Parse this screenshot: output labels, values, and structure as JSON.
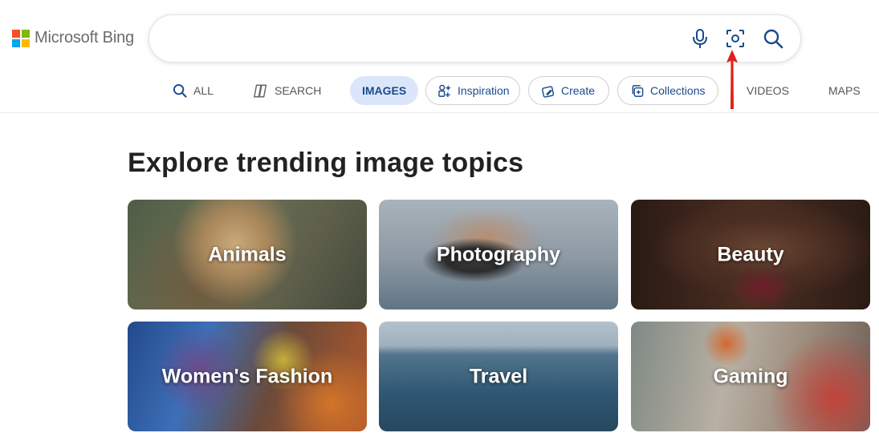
{
  "brand": {
    "logo_text": "Microsoft Bing",
    "colors": [
      "#f25022",
      "#7fba00",
      "#00a4ef",
      "#ffb900"
    ]
  },
  "search": {
    "query": "",
    "placeholder": "",
    "icons": [
      "microphone-icon",
      "visual-search-icon",
      "search-icon"
    ]
  },
  "nav": {
    "tabs": [
      {
        "label": "ALL",
        "icon": "search-icon"
      },
      {
        "label": "SEARCH",
        "icon": "copilot-icon"
      },
      {
        "label": "IMAGES",
        "active": true
      },
      {
        "label": "Inspiration",
        "icon": "sparkle-grid-icon"
      },
      {
        "label": "Create",
        "icon": "create-icon"
      },
      {
        "label": "Collections",
        "icon": "collections-icon"
      },
      {
        "label": "VIDEOS"
      },
      {
        "label": "MAPS"
      }
    ]
  },
  "annotation": {
    "color": "#e0201b",
    "icon": "red-arrow-annotation"
  },
  "main": {
    "heading": "Explore trending image topics",
    "topics": [
      {
        "label": "Animals"
      },
      {
        "label": "Photography"
      },
      {
        "label": "Beauty"
      },
      {
        "label": "Women's Fashion"
      },
      {
        "label": "Travel"
      },
      {
        "label": "Gaming"
      }
    ]
  },
  "colors": {
    "accent": "#1a4a8d",
    "active_tab_bg": "#dbe6fb"
  }
}
